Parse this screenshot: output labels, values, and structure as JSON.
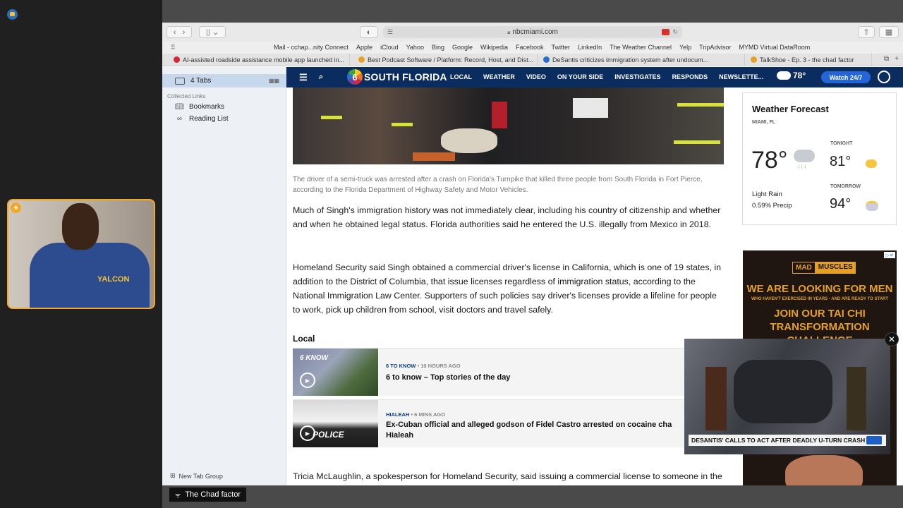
{
  "stream": {
    "bottom_label": "The Chad factor",
    "webcam_shirt_text": "YALCON"
  },
  "browser": {
    "url": "nbcmiami.com",
    "bookmarks": [
      "Mail - cchap...nity Connect",
      "Apple",
      "iCloud",
      "Yahoo",
      "Bing",
      "Google",
      "Wikipedia",
      "Facebook",
      "Twitter",
      "LinkedIn",
      "The Weather Channel",
      "Yelp",
      "TripAdvisor",
      "MYMD Virtual DataRoom"
    ],
    "tabs": [
      {
        "label": "AI-assisted roadside assistance mobile app launched in...",
        "color": "#d6263b"
      },
      {
        "label": "Best Podcast Software / Platform: Record, Host, and Dist...",
        "color": "#e8a125"
      },
      {
        "label": "DeSantis criticizes immigration system after undocum...",
        "color": "#2a6dc7"
      },
      {
        "label": "TalkShoe - Ep. 3 - the chad factor",
        "color": "#e8a125"
      }
    ]
  },
  "sidebar": {
    "tabs_label": "4 Tabs",
    "collected_header": "Collected Links",
    "items": [
      {
        "label": "Bookmarks",
        "icon": "book-icon"
      },
      {
        "label": "Reading List",
        "icon": "glasses-icon"
      }
    ],
    "new_tab_group": "New Tab Group"
  },
  "nbc": {
    "logo_text": "SOUTH FLORIDA",
    "logo_number": "6",
    "nav": [
      "LOCAL",
      "WEATHER",
      "VIDEO",
      "ON YOUR SIDE",
      "INVESTIGATES",
      "RESPONDS",
      "NEWSLETTE..."
    ],
    "nav_temp": "78°",
    "watch_label": "Watch 24/7"
  },
  "article": {
    "caption": "The driver of a semi-truck was arrested after a crash on Florida's Turnpike that killed three people from South Florida in Fort Pierce, according to the Florida Department of Highway Safety and Motor Vehicles.",
    "paragraph1": "Much of Singh's immigration history was not immediately clear, including his country of citizenship and whether and when he obtained legal status. Florida authorities said he entered the U.S. illegally from Mexico in 2018.",
    "paragraph2": "Homeland Security said Singh obtained a commercial driver's license in California, which is one of 19 states, in addition to the District of Columbia, that issue licenses regardless of immigration status, according to the National Immigration Law Center. Supporters of such policies say driver's licenses provide a lifeline for people to work, pick up children from school, visit doctors and travel safely.",
    "local_heading": "Local",
    "stories": [
      {
        "category": "6 TO KNOW",
        "time": "10 HOURS AGO",
        "title": "6 to know – Top stories of the day",
        "thumb_text": "6 KNOW"
      },
      {
        "category": "HIALEAH",
        "time": "6 MINS AGO",
        "title": "Ex-Cuban official and alleged godson of Fidel Castro arrested on cocaine cha",
        "title2": "Hialeah",
        "thumb_text": "POLICE"
      }
    ],
    "paragraph3": "Tricia McLaughlin, a spokesperson for Homeland Security, said issuing a commercial license to someone in the"
  },
  "weather": {
    "title": "Weather Forecast",
    "location": "MIAMI, FL",
    "current_temp": "78°",
    "condition": "Light Rain",
    "precip": "0.59% Precip",
    "tonight_label": "TONIGHT",
    "tonight_temp": "81°",
    "tomorrow_label": "TOMORROW",
    "tomorrow_temp": "94°"
  },
  "ad": {
    "brand1": "MAD",
    "brand2": "MUSCLES",
    "headline1": "WE ARE LOOKING FOR MEN",
    "headline2": "WHO HAVEN'T EXERCISED IN YEARS - AND ARE READY TO START",
    "headline3": "JOIN OUR TAI CHI TRANSFORMATION CHALLENGE"
  },
  "video": {
    "ticker": "DESANTIS' CALLS TO ACT AFTER DEADLY U-TURN CRASH"
  }
}
